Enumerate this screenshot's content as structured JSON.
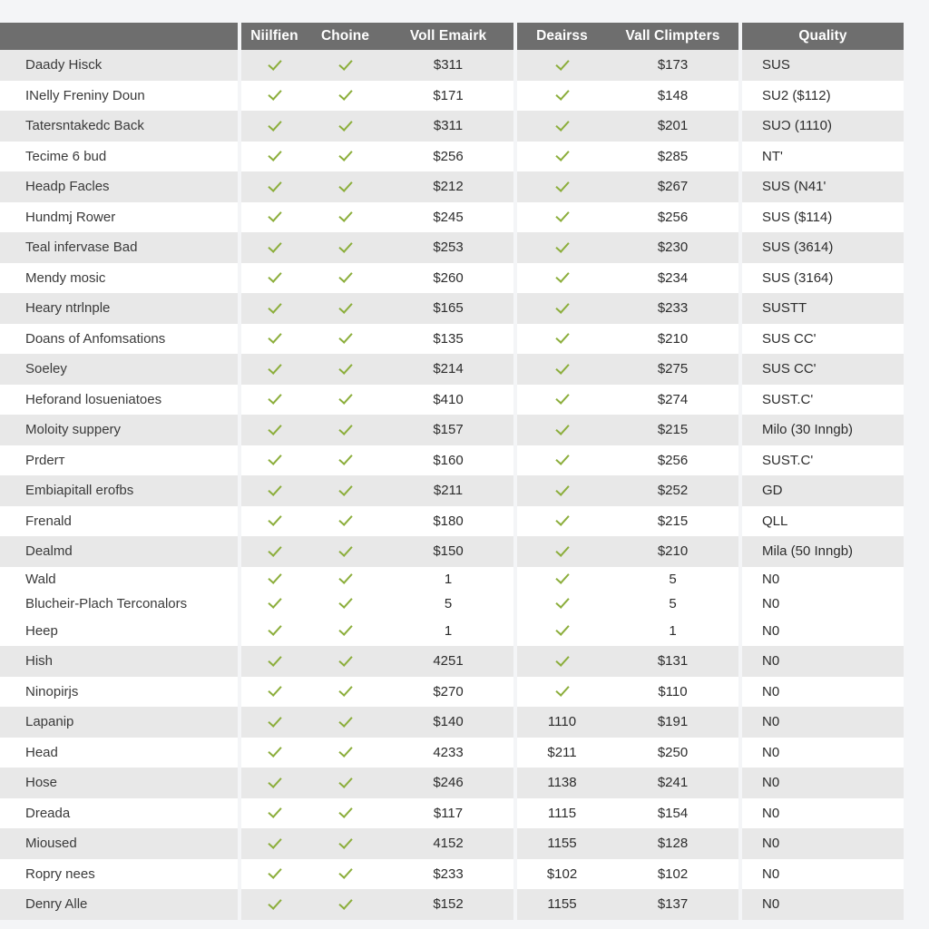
{
  "table": {
    "headers": {
      "name": "",
      "col_a": "Niilfien",
      "col_b": "Choine",
      "col_c": "Voll Emairk",
      "col_d": "Deairss",
      "col_e": "Vall Climpters",
      "col_q": "Quality"
    },
    "icons": {
      "check": "check-icon"
    },
    "colors": {
      "header_bg": "#6e6e6e",
      "header_text": "#ffffff",
      "row_odd_bg": "#e8e8e8",
      "row_even_bg": "#ffffff",
      "check_green": "#8cae3c",
      "page_bg": "#f4f5f7",
      "body_text": "#2c2c2c"
    },
    "rows": [
      {
        "name": "Daady Hisck",
        "a": "check",
        "b": "check",
        "c": "$311",
        "d": "check",
        "e": "$173",
        "q": "SUS"
      },
      {
        "name": "INelly Freniny Doun",
        "a": "check",
        "b": "check",
        "c": "$171",
        "d": "check",
        "e": "$148",
        "q": "SU2 ($112)"
      },
      {
        "name": "Tatersntakedc Back",
        "a": "check",
        "b": "check",
        "c": "$311",
        "d": "check",
        "e": "$201",
        "q": "SUƆ (1110)"
      },
      {
        "name": "Tecime 6 bud",
        "a": "check",
        "b": "check",
        "c": "$256",
        "d": "check",
        "e": "$285",
        "q": "NT'"
      },
      {
        "name": "Headp Facles",
        "a": "check",
        "b": "check",
        "c": "$212",
        "d": "check",
        "e": "$267",
        "q": "SUS (N41'"
      },
      {
        "name": "Hundmj Rower",
        "a": "check",
        "b": "check",
        "c": "$245",
        "d": "check",
        "e": "$256",
        "q": "SUS ($114)"
      },
      {
        "name": "Teal infervase Bad",
        "a": "check",
        "b": "check",
        "c": "$253",
        "d": "check",
        "e": "$230",
        "q": "SUS (3614)"
      },
      {
        "name": "Mendy mosic",
        "a": "check",
        "b": "check",
        "c": "$260",
        "d": "check",
        "e": "$234",
        "q": "SUS (3164)"
      },
      {
        "name": "Heary ntrlnple",
        "a": "check",
        "b": "check",
        "c": "$165",
        "d": "check",
        "e": "$233",
        "q": "SUSTT"
      },
      {
        "name": "Doans of Anfomsations",
        "a": "check",
        "b": "check",
        "c": "$135",
        "d": "check",
        "e": "$210",
        "q": "SUS CC'"
      },
      {
        "name": "Soeley",
        "a": "check",
        "b": "check",
        "c": "$214",
        "d": "check",
        "e": "$275",
        "q": "SUS CC'"
      },
      {
        "name": "Heforand losueniatoes",
        "a": "check",
        "b": "check",
        "c": "$410",
        "d": "check",
        "e": "$274",
        "q": "SUST.C'"
      },
      {
        "name": "Moloity suppery",
        "a": "check",
        "b": "check",
        "c": "$157",
        "d": "check",
        "e": "$215",
        "q": "Milo (30 Inngb)"
      },
      {
        "name": "Prderт",
        "a": "check",
        "b": "check",
        "c": "$160",
        "d": "check",
        "e": "$256",
        "q": "SUST.C'"
      },
      {
        "name": "Embiapitall erofbs",
        "a": "check",
        "b": "check",
        "c": "$211",
        "d": "check",
        "e": "$252",
        "q": "GD"
      },
      {
        "name": "Frenald",
        "a": "check",
        "b": "check",
        "c": "$180",
        "d": "check",
        "e": "$215",
        "q": "QLL"
      },
      {
        "name": "Dealmd",
        "a": "check",
        "b": "check",
        "c": "$150",
        "d": "check",
        "e": "$210",
        "q": "Mila (50 Inngb)"
      },
      {
        "name": "Wald",
        "a": "check",
        "b": "check",
        "c": "1",
        "d": "check",
        "e": "5",
        "q": "N0",
        "compact": "top"
      },
      {
        "name": "Blucheir-Plach Terconalors",
        "a": "check",
        "b": "check",
        "c": "5",
        "d": "check",
        "e": "5",
        "q": "N0",
        "compact": "bottom"
      },
      {
        "name": "Heep",
        "a": "check",
        "b": "check",
        "c": "1",
        "d": "check",
        "e": "1",
        "q": "N0"
      },
      {
        "name": "Hish",
        "a": "check",
        "b": "check",
        "c": "4251",
        "d": "check",
        "e": "$131",
        "q": "N0"
      },
      {
        "name": "Ninopirjs",
        "a": "check",
        "b": "check",
        "c": "$270",
        "d": "check",
        "e": "$110",
        "q": "N0"
      },
      {
        "name": "Lapanip",
        "a": "check",
        "b": "check",
        "c": "$140",
        "d": "1110",
        "e": "$191",
        "q": "N0"
      },
      {
        "name": "Head",
        "a": "check",
        "b": "check",
        "c": "4233",
        "d": "$211",
        "e": "$250",
        "q": "N0"
      },
      {
        "name": "Hose",
        "a": "check",
        "b": "check",
        "c": "$246",
        "d": "1138",
        "e": "$241",
        "q": "N0"
      },
      {
        "name": "Dreada",
        "a": "check",
        "b": "check",
        "c": "$117",
        "d": "1115",
        "e": "$154",
        "q": "N0"
      },
      {
        "name": "Mioused",
        "a": "check",
        "b": "check",
        "c": "4152",
        "d": "1155",
        "e": "$128",
        "q": "N0"
      },
      {
        "name": "Ropry nees",
        "a": "check",
        "b": "check",
        "c": "$233",
        "d": "$102",
        "e": "$102",
        "q": "N0"
      },
      {
        "name": "Denry Alle",
        "a": "check",
        "b": "check",
        "c": "$152",
        "d": "1155",
        "e": "$137",
        "q": "N0"
      }
    ]
  }
}
